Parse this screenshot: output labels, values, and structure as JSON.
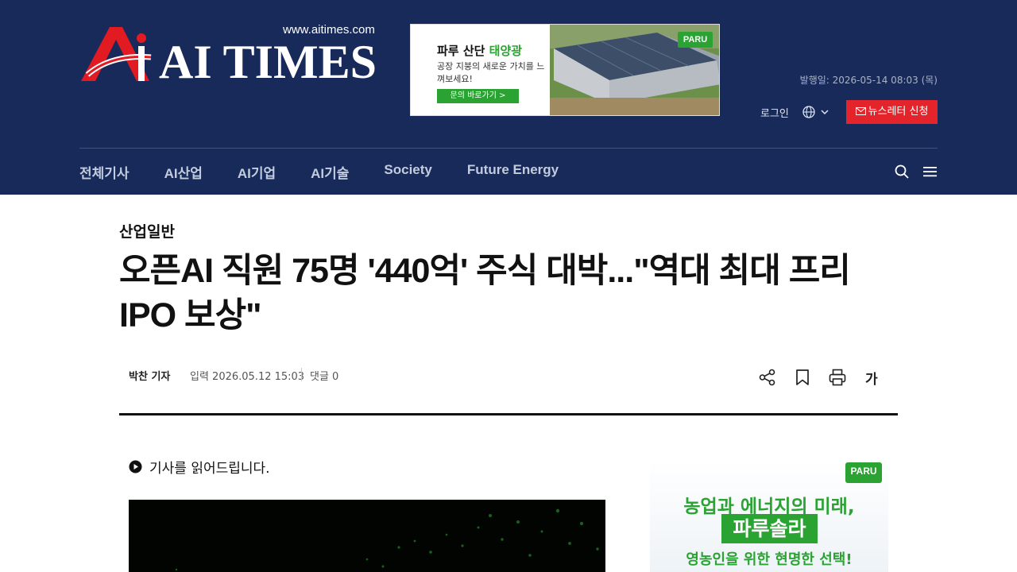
{
  "header": {
    "site_url": "www.aitimes.com",
    "logo_text": "AI TIMES",
    "publish_date": "발행일: 2026-05-14 08:03 (목)",
    "login_label": "로그인",
    "newsletter_label": "뉴스레터 신청",
    "bg_color": "#172a5a",
    "accent_red": "#e4242b"
  },
  "top_ad": {
    "headline_a": "파루 산단 ",
    "headline_b": "태양광",
    "sub": "공장 지붕의 새로운 가치를 느껴보세요!",
    "button": "문의 바로가기 >",
    "brand": "PARU"
  },
  "nav": {
    "items": [
      "전체기사",
      "AI산업",
      "AI기업",
      "AI기술",
      "Society",
      "Future Energy"
    ]
  },
  "article": {
    "category": "산업일반",
    "title": "오픈AI 직원 75명 '440억' 주식 대박...\"역대 최대 프리 IPO 보상\"",
    "reporter": "박찬 기자",
    "input_date": "입력 2026.05.12 15:03",
    "comments": "댓글 0",
    "font_size_tool": "가",
    "tts_label": "기사를 읽어드립니다."
  },
  "side_ad": {
    "brand": "PARU",
    "line1": "농업과 에너지의 미래,",
    "line2": "파루솔라",
    "line3": "영농인을 위한 현명한 선택!",
    "brand_green": "#2aa332"
  }
}
